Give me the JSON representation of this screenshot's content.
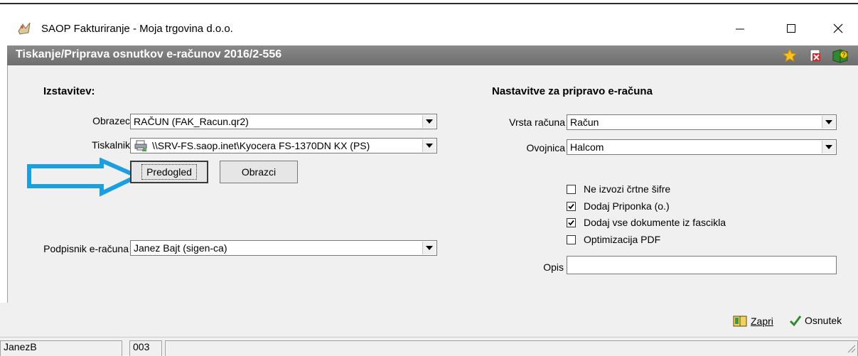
{
  "window": {
    "title": "SAOP Fakturiranje - Moja trgovina d.o.o.",
    "minimize_glyph": "—",
    "maximize_glyph": "☐",
    "close_glyph": "✕"
  },
  "form": {
    "title": "Tiskanje/Priprava osnutkov e-računov 2016/2-556",
    "header_icons": [
      "star-icon",
      "delete-icon",
      "help-icon"
    ]
  },
  "left": {
    "section_title": "Izstavitev:",
    "obrazec_label": "Obrazec",
    "obrazec_value": "RAČUN  (FAK_Racun.qr2)",
    "tiskalnik_label": "Tiskalnik",
    "tiskalnik_value": "\\\\SRV-FS.saop.inet\\Kyocera FS-1370DN KX (PS)",
    "preview_button": "Predogled",
    "forms_button": "Obrazci",
    "signer_label": "Podpisnik e-računa",
    "signer_value": "Janez Bajt (sigen-ca)"
  },
  "right": {
    "section_title": "Nastavitve za pripravo e-računa",
    "vrsta_label": "Vrsta računa",
    "vrsta_value": "Račun",
    "ovojnica_label": "Ovojnica",
    "ovojnica_value": "Halcom",
    "checkboxes": [
      {
        "label": "Ne izvozi črtne šifre",
        "checked": false
      },
      {
        "label": "Dodaj Priponka (o.)",
        "checked": true
      },
      {
        "label": "Dodaj vse dokumente iz fascikla",
        "checked": true
      },
      {
        "label": "Optimizacija PDF",
        "checked": false
      }
    ],
    "opis_label": "Opis",
    "opis_value": ""
  },
  "footer": {
    "close_label": "Zapri",
    "draft_label": "Osnutek"
  },
  "status": {
    "user": "JanezB",
    "code": "003"
  },
  "colors": {
    "arrow": "#1a9fe0",
    "header_bg": "#7a7a7a",
    "panel_bg": "#f0f0f0",
    "check_green": "#2e8b2e"
  }
}
